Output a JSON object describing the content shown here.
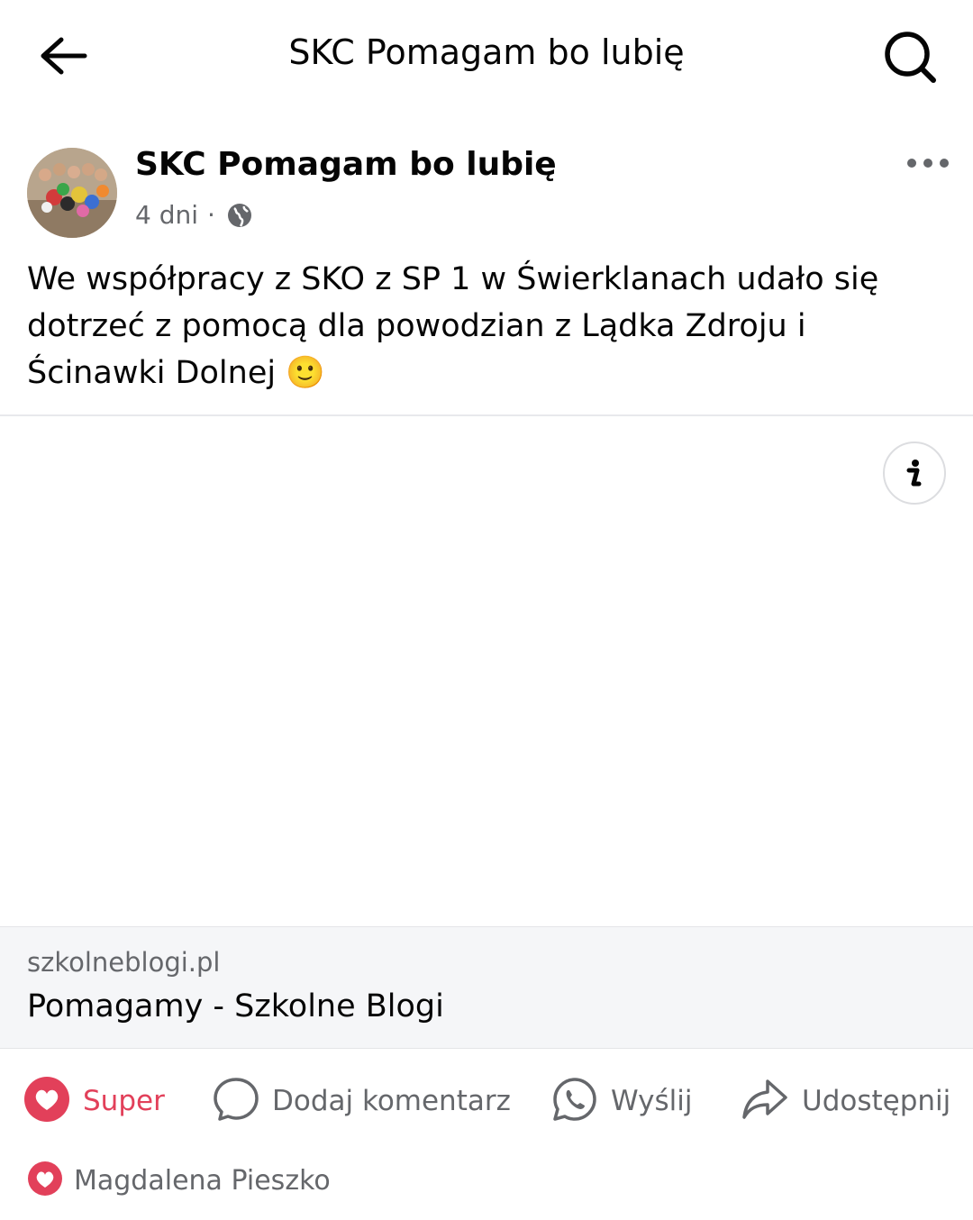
{
  "header": {
    "title": "SKC Pomagam bo lubię",
    "back_icon": "arrow-left-icon",
    "search_icon": "search-icon"
  },
  "post": {
    "author": "SKC Pomagam bo lubię",
    "time": "4 dni",
    "separator": "·",
    "privacy_icon": "globe-icon",
    "more_icon": "more-horizontal-icon",
    "text": "We współpracy z SKO z SP 1 w Świerklanach udało się dotrzeć z pomocą dla powodzian z Lądka Zdroju i Ścinawki Dolnej 🙂"
  },
  "link_preview": {
    "info_icon": "info-icon",
    "domain": "szkolneblogi.pl",
    "title": "Pomagamy - Szkolne Blogi"
  },
  "actions": {
    "super": "Super",
    "comment": "Dodaj komentarz",
    "send": "Wyślij",
    "share": "Udostępnij"
  },
  "reactions": {
    "names": "Magdalena Pieszko"
  },
  "colors": {
    "love": "#e2405a",
    "secondary_text": "#65676b",
    "primary_text": "#050505"
  }
}
